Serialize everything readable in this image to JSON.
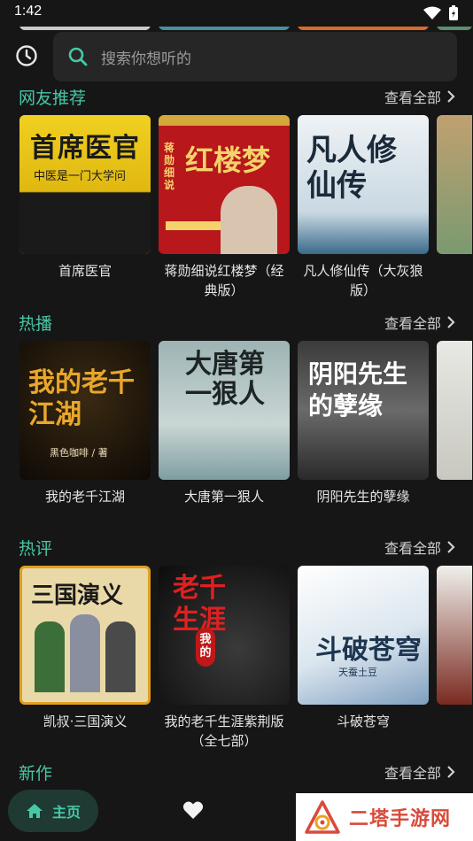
{
  "status": {
    "time": "1:42"
  },
  "search": {
    "placeholder": "搜索你想听的"
  },
  "sections": [
    {
      "title": "网友推荐",
      "view_all": "查看全部",
      "items": [
        {
          "title": "首席医官",
          "cover_text": "首席医官",
          "cover_sub": "中医是一门大学问"
        },
        {
          "title": "蒋勋细说红楼梦（经典版）",
          "cover_text": "红楼梦",
          "cover_sub": "蒋勋细说"
        },
        {
          "title": "凡人修仙传（大灰狼版）",
          "cover_text": "凡人修仙传",
          "cover_sub": ""
        }
      ]
    },
    {
      "title": "热播",
      "view_all": "查看全部",
      "items": [
        {
          "title": "我的老千江湖",
          "cover_text": "我的老千江湖",
          "cover_sub": "黑色咖啡 / 著"
        },
        {
          "title": "大唐第一狠人",
          "cover_text": "大唐第一狠人",
          "cover_sub": ""
        },
        {
          "title": "阴阳先生的孽缘",
          "cover_text": "阴阳先生的孽缘",
          "cover_sub": ""
        }
      ]
    },
    {
      "title": "热评",
      "view_all": "查看全部",
      "items": [
        {
          "title": "凯叔·三国演义",
          "cover_text": "三国演义",
          "cover_sub": ""
        },
        {
          "title": "我的老千生涯紫荆版（全七部）",
          "cover_text": "老千生涯",
          "cover_sub": "我的"
        },
        {
          "title": "斗破苍穹",
          "cover_text": "斗破苍穹",
          "cover_sub": "天蚕土豆"
        }
      ]
    },
    {
      "title": "新作",
      "view_all": "查看全部",
      "items": []
    }
  ],
  "nav": {
    "home_label": "主页"
  },
  "watermark": {
    "text": "二塔手游网"
  },
  "colors": {
    "accent": "#47c7a6",
    "background": "#161616",
    "search_bg": "#262626"
  }
}
